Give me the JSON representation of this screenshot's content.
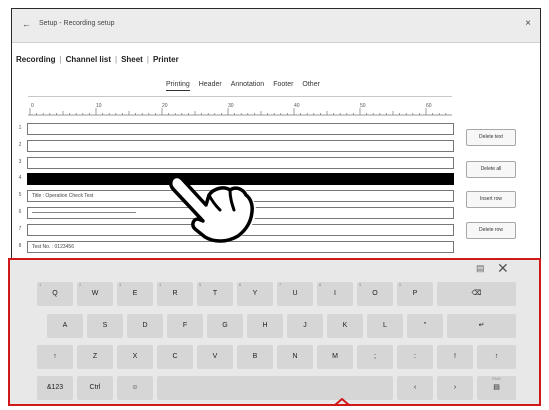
{
  "window": {
    "back_glyph": "←",
    "title": "Setup - Recording setup",
    "close_glyph": "×"
  },
  "main_tabs": [
    "Recording",
    "Channel list",
    "Sheet",
    "Printer"
  ],
  "sub_tabs": [
    "Printing",
    "Header",
    "Annotation",
    "Footer",
    "Other"
  ],
  "ruler_labels": [
    "0",
    "10",
    "20",
    "30",
    "40",
    "50",
    "60"
  ],
  "rows": [
    {
      "num": "1",
      "text": ""
    },
    {
      "num": "2",
      "text": ""
    },
    {
      "num": "3",
      "text": ""
    },
    {
      "num": "4",
      "text": "",
      "selected": true
    },
    {
      "num": "5",
      "text": "Title : Operation Check Test"
    },
    {
      "num": "6",
      "text": "",
      "dashes": true
    },
    {
      "num": "7",
      "text": ""
    },
    {
      "num": "8",
      "text": "Test No.        : 0123456"
    }
  ],
  "buttons": [
    "Delete text",
    "Delete all",
    "Insert row",
    "Delete row"
  ],
  "keyboard": {
    "top_icon": "▤",
    "close_glyph": "✕",
    "row1": [
      {
        "main": "Q",
        "sm": "1"
      },
      {
        "main": "W",
        "sm": "2"
      },
      {
        "main": "E",
        "sm": "3"
      },
      {
        "main": "R",
        "sm": "4"
      },
      {
        "main": "T",
        "sm": "5"
      },
      {
        "main": "Y",
        "sm": "6"
      },
      {
        "main": "U",
        "sm": "7"
      },
      {
        "main": "I",
        "sm": "8"
      },
      {
        "main": "O",
        "sm": "9"
      },
      {
        "main": "P",
        "sm": "0"
      },
      {
        "main": "⌫",
        "sm": ""
      }
    ],
    "row2": [
      "A",
      "S",
      "D",
      "F",
      "G",
      "H",
      "J",
      "K",
      "L",
      "\"",
      "↵"
    ],
    "row3": [
      "↑",
      "Z",
      "X",
      "C",
      "V",
      "B",
      "N",
      "M",
      ";",
      ":",
      "!",
      "↑"
    ],
    "row4": {
      "sym": "&123",
      "ctrl": "Ctrl",
      "emoji": "☺",
      "left": "‹",
      "right": "›",
      "lang": "ENG"
    }
  }
}
